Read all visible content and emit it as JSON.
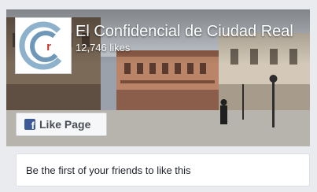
{
  "page": {
    "name": "El Confidencial de Ciudad Real",
    "likes": "12,746 likes"
  },
  "actions": {
    "like_label": "Like Page",
    "facebook_glyph": "f"
  },
  "social_context": "Be the first of your friends to like this",
  "icons": {
    "avatar": "ecr-logo-icon",
    "facebook": "facebook-f-icon"
  },
  "colors": {
    "facebook_blue": "#3b5998",
    "logo_blue": "#8fb2cc",
    "logo_red": "#c0392b"
  }
}
